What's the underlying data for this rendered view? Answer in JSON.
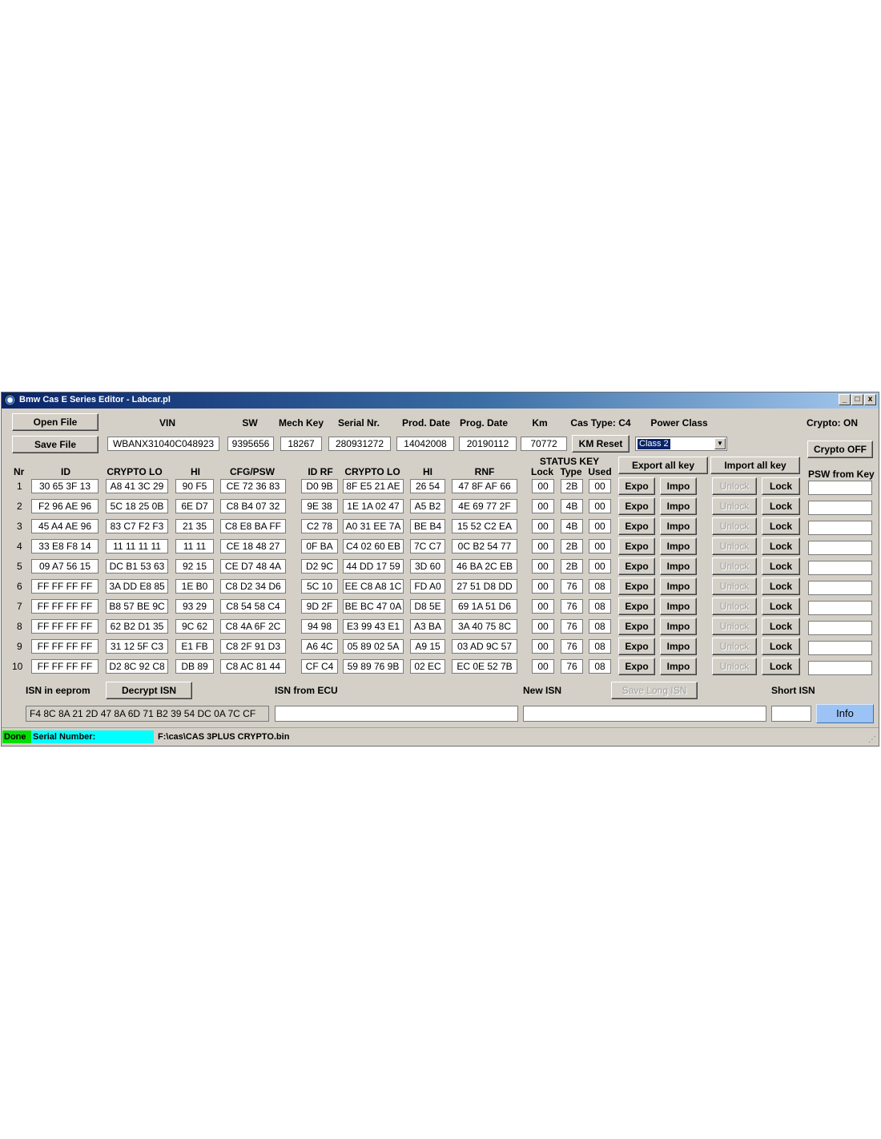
{
  "window": {
    "title": "Bmw Cas E Series Editor - Labcar.pl",
    "controls": [
      "_",
      "□",
      "x"
    ]
  },
  "top": {
    "open_file": "Open File",
    "save_file": "Save File",
    "labels": {
      "vin": "VIN",
      "sw": "SW",
      "mech_key": "Mech Key",
      "serial": "Serial Nr.",
      "prod_date": "Prod. Date",
      "prog_date": "Prog. Date",
      "km": "Km",
      "cas_type": "Cas Type: C4",
      "power_class": "Power Class",
      "crypto": "Crypto: ON"
    },
    "values": {
      "vin": "WBANX31040C048923",
      "sw": "9395656",
      "mech_key": "18267",
      "serial": "280931272",
      "prod_date": "14042008",
      "prog_date": "20190112",
      "km": "70772"
    },
    "km_reset": "KM Reset",
    "power_class_value": "Class 2",
    "crypto_off": "Crypto OFF"
  },
  "table": {
    "headers": {
      "nr": "Nr",
      "id": "ID",
      "crypto_lo": "CRYPTO LO",
      "hi": "HI",
      "cfg": "CFG/PSW",
      "id_rf": "ID RF",
      "crypto_lo2": "CRYPTO LO",
      "hi2": "HI",
      "rnf": "RNF",
      "status_key": "STATUS KEY",
      "lock": "Lock",
      "type": "Type",
      "used": "Used",
      "psw_from_key": "PSW from Key"
    },
    "export_all": "Export all key",
    "import_all": "Import all key",
    "expo": "Expo",
    "impo": "Impo",
    "unlock": "Unlock",
    "lock": "Lock",
    "rows": [
      {
        "nr": "1",
        "id": "30 65 3F 13",
        "clo": "A8 41 3C 29",
        "hi": "90 F5",
        "cfg": "CE 72 36 83",
        "idrf": "D0 9B",
        "clo2": "8F E5 21 AE",
        "hi2": "26 54",
        "rnf": "47 8F AF 66",
        "lock": "00",
        "type": "2B",
        "used": "00",
        "psw": ""
      },
      {
        "nr": "2",
        "id": "F2 96 AE 96",
        "clo": "5C 18 25 0B",
        "hi": "6E D7",
        "cfg": "C8 B4 07 32",
        "idrf": "9E 38",
        "clo2": "1E 1A 02 47",
        "hi2": "A5 B2",
        "rnf": "4E 69 77 2F",
        "lock": "00",
        "type": "4B",
        "used": "00",
        "psw": ""
      },
      {
        "nr": "3",
        "id": "45 A4 AE 96",
        "clo": "83 C7 F2 F3",
        "hi": "21 35",
        "cfg": "C8 E8 BA FF",
        "idrf": "C2 78",
        "clo2": "A0 31 EE 7A",
        "hi2": "BE B4",
        "rnf": "15 52 C2 EA",
        "lock": "00",
        "type": "4B",
        "used": "00",
        "psw": ""
      },
      {
        "nr": "4",
        "id": "33 E8 F8 14",
        "clo": "11 11 11 11",
        "hi": "11 11",
        "cfg": "CE 18 48 27",
        "idrf": "0F BA",
        "clo2": "C4 02 60 EB",
        "hi2": "7C C7",
        "rnf": "0C B2 54 77",
        "lock": "00",
        "type": "2B",
        "used": "00",
        "psw": ""
      },
      {
        "nr": "5",
        "id": "09 A7 56 15",
        "clo": "DC B1 53 63",
        "hi": "92 15",
        "cfg": "CE D7 48 4A",
        "idrf": "D2 9C",
        "clo2": "44 DD 17 59",
        "hi2": "3D 60",
        "rnf": "46 BA 2C EB",
        "lock": "00",
        "type": "2B",
        "used": "00",
        "psw": ""
      },
      {
        "nr": "6",
        "id": "FF FF FF FF",
        "clo": "3A DD E8 85",
        "hi": "1E B0",
        "cfg": "C8 D2 34 D6",
        "idrf": "5C 10",
        "clo2": "EE C8 A8 1C",
        "hi2": "FD A0",
        "rnf": "27 51 D8 DD",
        "lock": "00",
        "type": "76",
        "used": "08",
        "psw": ""
      },
      {
        "nr": "7",
        "id": "FF FF FF FF",
        "clo": "B8 57 BE 9C",
        "hi": "93 29",
        "cfg": "C8 54 58 C4",
        "idrf": "9D 2F",
        "clo2": "BE BC 47 0A",
        "hi2": "D8 5E",
        "rnf": "69 1A 51 D6",
        "lock": "00",
        "type": "76",
        "used": "08",
        "psw": ""
      },
      {
        "nr": "8",
        "id": "FF FF FF FF",
        "clo": "62 B2 D1 35",
        "hi": "9C 62",
        "cfg": "C8 4A 6F 2C",
        "idrf": "94 98",
        "clo2": "E3 99 43 E1",
        "hi2": "A3 BA",
        "rnf": "3A 40 75 8C",
        "lock": "00",
        "type": "76",
        "used": "08",
        "psw": ""
      },
      {
        "nr": "9",
        "id": "FF FF FF FF",
        "clo": "31 12 5F C3",
        "hi": "E1 FB",
        "cfg": "C8 2F 91 D3",
        "idrf": "A6 4C",
        "clo2": "05 89 02 5A",
        "hi2": "A9 15",
        "rnf": "03 AD 9C 57",
        "lock": "00",
        "type": "76",
        "used": "08",
        "psw": ""
      },
      {
        "nr": "10",
        "id": "FF FF FF FF",
        "clo": "D2 8C 92 C8",
        "hi": "DB 89",
        "cfg": "C8 AC 81 44",
        "idrf": "CF C4",
        "clo2": "59 89 76 9B",
        "hi2": "02 EC",
        "rnf": "EC 0E 52 7B",
        "lock": "00",
        "type": "76",
        "used": "08",
        "psw": ""
      }
    ]
  },
  "bottom": {
    "isn_eeprom_label": "ISN in eeprom",
    "decrypt_isn": "Decrypt ISN",
    "isn_ecu_label": "ISN from ECU",
    "new_isn_label": "New ISN",
    "save_long_isn": "Save Long ISN",
    "short_isn_label": "Short ISN",
    "isn_eeprom_value": "F4 8C 8A 21 2D 47 8A 6D 71 B2 39 54 DC 0A 7C CF",
    "isn_ecu_value": "",
    "new_isn_value": "",
    "short_isn_value": "",
    "info": "Info"
  },
  "status": {
    "done": "Done",
    "serial_label": "Serial Number:",
    "path": "F:\\cas\\CAS 3PLUS CRYPTO.bin",
    "colors": {
      "done": "#00e000",
      "serial": "#00ffff"
    }
  }
}
